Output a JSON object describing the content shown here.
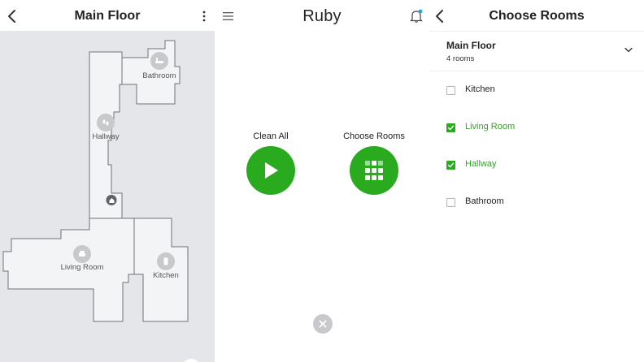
{
  "map_screen": {
    "title": "Main Floor",
    "rooms": [
      {
        "name": "Bathroom",
        "icon": "bathtub-icon"
      },
      {
        "name": "Hallway",
        "icon": "footprints-icon"
      },
      {
        "name": "Living Room",
        "icon": "armchair-icon"
      },
      {
        "name": "Kitchen",
        "icon": "refrigerator-icon"
      }
    ],
    "dock_icon": "home-base-icon"
  },
  "home_screen": {
    "title": "Ruby",
    "clean_all_label": "Clean All",
    "choose_rooms_label": "Choose Rooms",
    "accent_color": "#2aaa1e",
    "notification_dot_color": "#1ea7e0"
  },
  "rooms_screen": {
    "title": "Choose Rooms",
    "floor_name": "Main Floor",
    "floor_room_count": "4 rooms",
    "rooms": [
      {
        "name": "Kitchen",
        "checked": false
      },
      {
        "name": "Living Room",
        "checked": true
      },
      {
        "name": "Hallway",
        "checked": true
      },
      {
        "name": "Bathroom",
        "checked": false
      }
    ]
  }
}
